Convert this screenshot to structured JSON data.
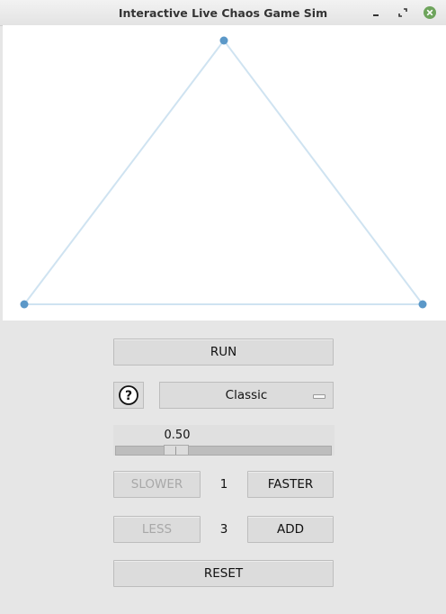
{
  "window": {
    "title": "Interactive Live Chaos Game Sim"
  },
  "controls": {
    "run_label": "RUN",
    "help_glyph": "?",
    "mode_selected": "Classic",
    "ratio_value": "0.50",
    "ratio_level": 0.5,
    "slower_label": "SLOWER",
    "speed_value": "1",
    "faster_label": "FASTER",
    "less_label": "LESS",
    "vertex_count": "3",
    "add_label": "ADD",
    "reset_label": "RESET"
  },
  "colors": {
    "vertex": "#5b98c8",
    "edge": "#cfe3f1",
    "canvas_bg": "#ffffff",
    "panel_bg": "#e6e6e6"
  }
}
